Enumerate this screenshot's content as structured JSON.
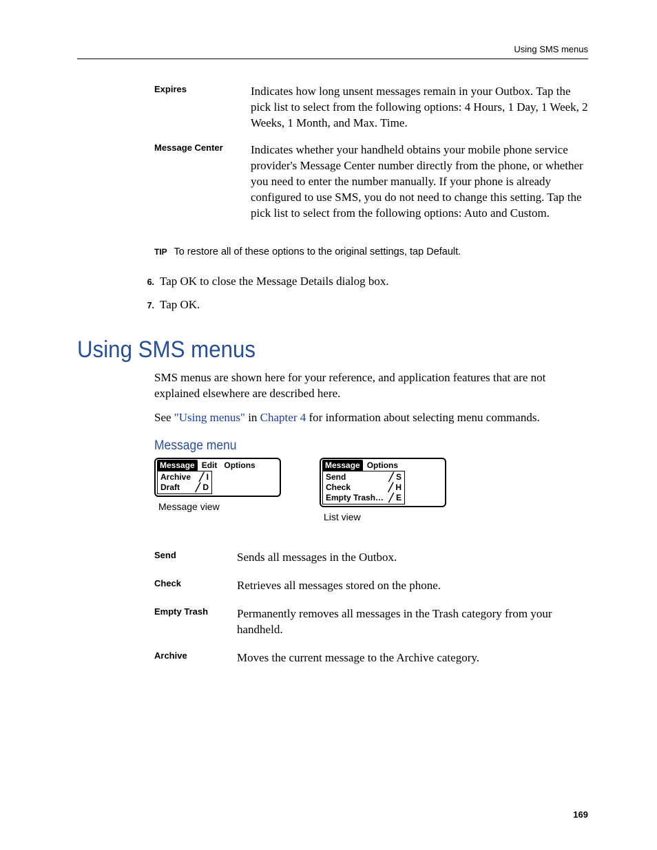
{
  "header": {
    "running_head": "Using SMS menus"
  },
  "options_table": [
    {
      "term": "Expires",
      "desc": "Indicates how long unsent messages remain in your Outbox. Tap the pick list to select from the following options: 4 Hours, 1 Day, 1 Week, 2 Weeks, 1 Month, and Max. Time."
    },
    {
      "term": "Message Center",
      "desc": "Indicates whether your handheld obtains your mobile phone service provider's Message Center number directly from the phone, or whether you need to enter the number manually. If your phone is already configured to use SMS, you do not need to change this setting. Tap the pick list to select from the following options: Auto and Custom."
    }
  ],
  "tip": {
    "label": "TIP",
    "text": "To restore all of these options to the original settings, tap Default."
  },
  "steps": [
    {
      "num": "6.",
      "text": "Tap OK to close the Message Details dialog box."
    },
    {
      "num": "7.",
      "text": "Tap OK."
    }
  ],
  "section_title": "Using SMS menus",
  "intro_para": "SMS menus are shown here for your reference, and application features that are not explained elsewhere are described here.",
  "see_para": {
    "prefix": "See ",
    "link1": "\"Using menus\"",
    "mid": " in ",
    "link2": "Chapter 4",
    "suffix": " for information about selecting menu commands."
  },
  "subsection_title": "Message menu",
  "menu_figs": {
    "left": {
      "tabs": [
        "Message",
        "Edit",
        "Options"
      ],
      "rows": [
        {
          "label": "Archive",
          "shortcut": "╱ I"
        },
        {
          "label": "Draft",
          "shortcut": "╱ D"
        }
      ],
      "caption": "Message view"
    },
    "right": {
      "tabs": [
        "Message",
        "Options"
      ],
      "rows": [
        {
          "label": "Send",
          "shortcut": "╱ S"
        },
        {
          "label": "Check",
          "shortcut": "╱ H"
        },
        {
          "label": "Empty Trash…",
          "shortcut": "╱ E"
        }
      ],
      "caption": "List view"
    }
  },
  "cmd_table": [
    {
      "term": "Send",
      "desc": "Sends all messages in the Outbox."
    },
    {
      "term": "Check",
      "desc": "Retrieves all messages stored on the phone."
    },
    {
      "term": "Empty Trash",
      "desc": "Permanently removes all messages in the Trash category from your handheld."
    },
    {
      "term": "Archive",
      "desc": "Moves the current message to the Archive category."
    }
  ],
  "page_number": "169"
}
